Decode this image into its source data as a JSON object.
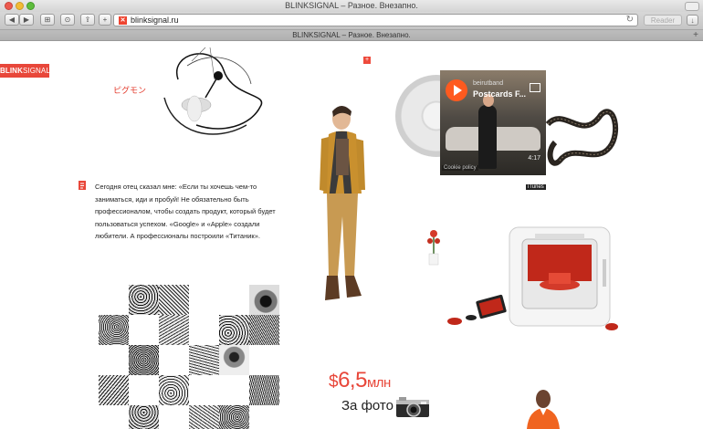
{
  "window": {
    "title": "BLINKSIGNAL – Разное. Внезапно.",
    "traffic_lights": [
      "close",
      "minimize",
      "zoom"
    ]
  },
  "toolbar": {
    "back_icon": "back-arrow-icon",
    "forward_icon": "forward-arrow-icon",
    "address_url": "blinksignal.ru",
    "favicon_text": "✕",
    "reader_label": "Reader"
  },
  "tab": {
    "title": "BLINKSIGNAL – Разное. Внезапно."
  },
  "page": {
    "logo_bold": "BLINK",
    "logo_rest": "SIGNAL",
    "japanese_label": "ピグモン",
    "quote": "Сегодня отец сказал мне: «Если ты хочешь чем-то заниматься, иди и пробуй! Не обязательно быть профессионалом, чтобы создать продукт, который будет пользоваться успехом. «Google» и «Apple» создали любители. А профессионалы построили «Титаник».",
    "video": {
      "channel": "beirutband",
      "title": "Postcards F...",
      "duration": "4:17",
      "cookie_text": "Cookie policy",
      "badge": "iTunes"
    },
    "price": {
      "currency": "$",
      "amount": "6,5",
      "unit": "млн"
    },
    "photo_label": "За фото",
    "colors": {
      "brand_red": "#e8473a",
      "text": "#222222"
    }
  }
}
